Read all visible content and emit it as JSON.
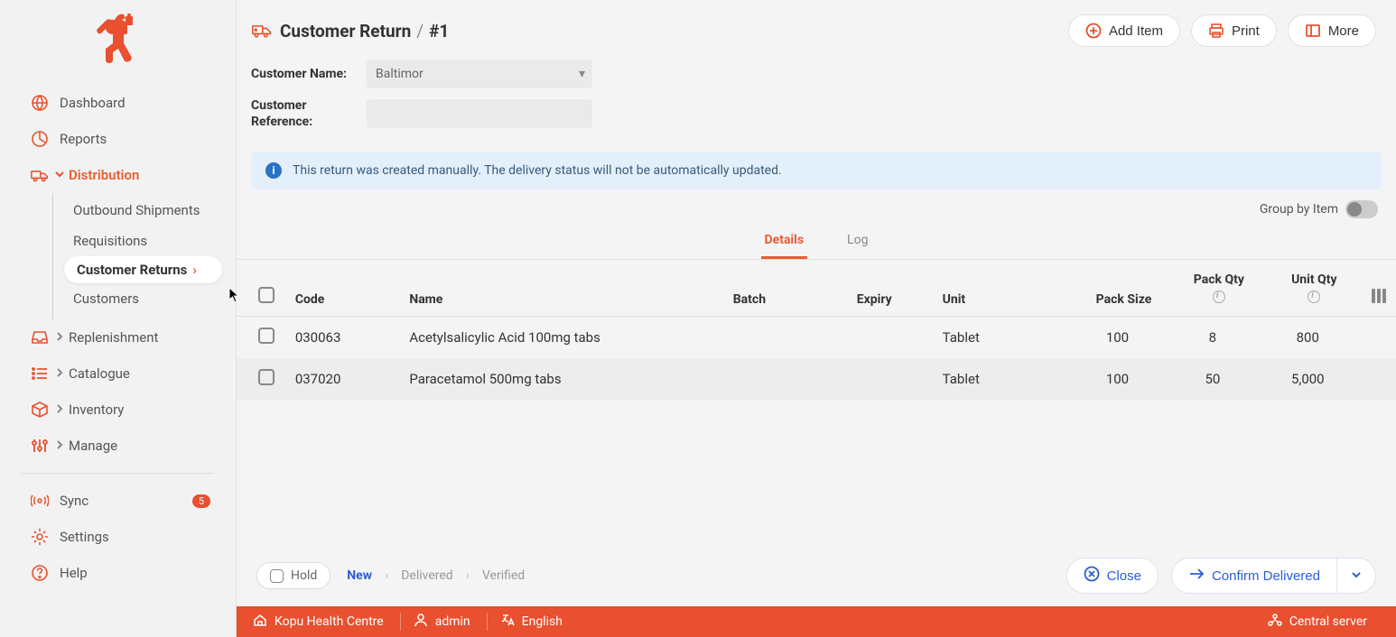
{
  "sidebar": {
    "items": [
      {
        "label": "Dashboard",
        "icon": "globe"
      },
      {
        "label": "Reports",
        "icon": "pie"
      },
      {
        "label": "Distribution",
        "icon": "truck",
        "active": true,
        "children": [
          {
            "label": "Outbound Shipments"
          },
          {
            "label": "Requisitions"
          },
          {
            "label": "Customer Returns",
            "active": true
          },
          {
            "label": "Customers"
          }
        ]
      },
      {
        "label": "Replenishment",
        "icon": "inbox"
      },
      {
        "label": "Catalogue",
        "icon": "list"
      },
      {
        "label": "Inventory",
        "icon": "cube"
      },
      {
        "label": "Manage",
        "icon": "sliders"
      },
      {
        "label": "Sync",
        "icon": "broadcast",
        "badge": "5"
      },
      {
        "label": "Settings",
        "icon": "gear"
      },
      {
        "label": "Help",
        "icon": "help"
      }
    ]
  },
  "header": {
    "title": "Customer Return",
    "id": "#1",
    "actions": {
      "add": "Add Item",
      "print": "Print",
      "more": "More"
    }
  },
  "form": {
    "customer_name_label": "Customer Name:",
    "customer_name_value": "Baltimor",
    "customer_ref_label": "Customer Reference:",
    "customer_ref_value": ""
  },
  "banner": "This return was created manually. The delivery status will not be automatically updated.",
  "group_by_item_label": "Group by Item",
  "tabs": {
    "details": "Details",
    "log": "Log"
  },
  "table": {
    "headers": {
      "code": "Code",
      "name": "Name",
      "batch": "Batch",
      "expiry": "Expiry",
      "unit": "Unit",
      "pack_size": "Pack Size",
      "pack_qty": "Pack Qty",
      "unit_qty": "Unit Qty"
    },
    "rows": [
      {
        "code": "030063",
        "name": "Acetylsalicylic Acid 100mg tabs",
        "batch": "",
        "expiry": "",
        "unit": "Tablet",
        "pack_size": "100",
        "pack_qty": "8",
        "unit_qty": "800"
      },
      {
        "code": "037020",
        "name": "Paracetamol 500mg tabs",
        "batch": "",
        "expiry": "",
        "unit": "Tablet",
        "pack_size": "100",
        "pack_qty": "50",
        "unit_qty": "5,000"
      }
    ]
  },
  "footer": {
    "hold": "Hold",
    "statuses": {
      "new": "New",
      "delivered": "Delivered",
      "verified": "Verified"
    },
    "close": "Close",
    "confirm": "Confirm Delivered"
  },
  "bottombar": {
    "facility": "Kopu Health Centre",
    "user": "admin",
    "language": "English",
    "server": "Central server"
  }
}
